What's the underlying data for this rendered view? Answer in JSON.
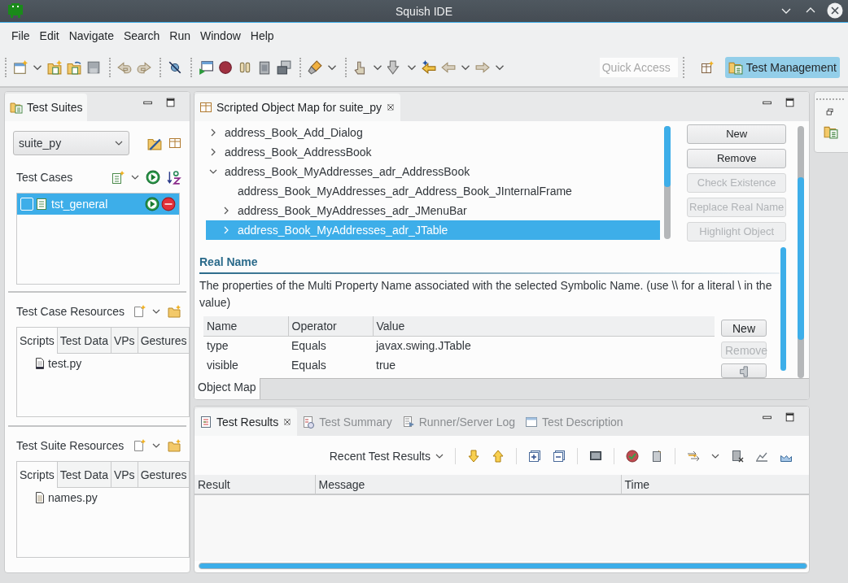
{
  "window": {
    "title": "Squish IDE"
  },
  "menu": [
    {
      "label": "File"
    },
    {
      "label": "Edit"
    },
    {
      "label": "Navigate"
    },
    {
      "label": "Search"
    },
    {
      "label": "Run"
    },
    {
      "label": "Window"
    },
    {
      "label": "Help"
    }
  ],
  "toolbar": {
    "quick_access": {
      "placeholder": "Quick Access"
    },
    "perspective": {
      "label": "Test Management",
      "selected": true
    }
  },
  "test_suites": {
    "tab": "Test Suites",
    "suite_select": {
      "value": "suite_py"
    },
    "test_cases": {
      "title": "Test Cases",
      "items": [
        {
          "name": "tst_general",
          "checked": false,
          "selected": true
        }
      ]
    },
    "test_case_resources": {
      "title": "Test Case Resources",
      "tabs": [
        {
          "label": "Scripts",
          "selected": true
        },
        {
          "label": "Test Data",
          "selected": false
        },
        {
          "label": "VPs",
          "selected": false
        },
        {
          "label": "Gestures",
          "selected": false
        }
      ],
      "files": [
        {
          "name": "test.py"
        }
      ]
    },
    "test_suite_resources": {
      "title": "Test Suite Resources",
      "tabs": [
        {
          "label": "Scripts",
          "selected": true
        },
        {
          "label": "Test Data",
          "selected": false
        },
        {
          "label": "VPs",
          "selected": false
        },
        {
          "label": "Gestures",
          "selected": false
        }
      ],
      "files": [
        {
          "name": "names.py"
        }
      ]
    }
  },
  "object_map": {
    "tab": "Scripted Object Map for suite_py",
    "tree": [
      {
        "label": "address_Book_Add_Dialog",
        "kind": "branch",
        "expanded": false,
        "selected": false
      },
      {
        "label": "address_Book_AddressBook",
        "kind": "branch",
        "expanded": false,
        "selected": false
      },
      {
        "label": "address_Book_MyAddresses_adr_AddressBook",
        "kind": "branch",
        "expanded": true,
        "selected": false,
        "children": [
          {
            "label": "address_Book_MyAddresses_adr_Address_Book_JInternalFrame",
            "kind": "leaf",
            "selected": false
          },
          {
            "label": "address_Book_MyAddresses_adr_JMenuBar",
            "kind": "branch",
            "expanded": false,
            "selected": false
          },
          {
            "label": "address_Book_MyAddresses_adr_JTable",
            "kind": "branch",
            "expanded": false,
            "selected": true
          }
        ]
      }
    ],
    "buttons": [
      {
        "label": "New",
        "disabled": false
      },
      {
        "label": "Remove",
        "disabled": false
      },
      {
        "label": "Check Existence",
        "disabled": true
      },
      {
        "label": "Replace Real Name",
        "disabled": true
      },
      {
        "label": "Highlight Object",
        "disabled": true
      }
    ],
    "real_name": {
      "heading": "Real Name",
      "description": "The properties of the Multi Property Name associated with the selected Symbolic Name. (use \\\\ for a literal \\ in the value)",
      "columns": [
        "Name",
        "Operator",
        "Value"
      ],
      "rows": [
        [
          "type",
          "Equals",
          "javax.swing.JTable"
        ],
        [
          "visible",
          "Equals",
          "true"
        ]
      ],
      "buttons": [
        {
          "label": "New",
          "disabled": false
        },
        {
          "label": "Remove",
          "disabled": true
        }
      ]
    },
    "bottom_tabs": [
      {
        "label": "Object Map",
        "selected": true
      }
    ]
  },
  "results": {
    "tabs": [
      {
        "label": "Test Results",
        "selected": true
      },
      {
        "label": "Test Summary",
        "selected": false
      },
      {
        "label": "Runner/Server Log",
        "selected": false
      },
      {
        "label": "Test Description",
        "selected": false
      }
    ],
    "recent": "Recent Test Results",
    "columns": [
      "Result",
      "Message",
      "Time"
    ]
  }
}
